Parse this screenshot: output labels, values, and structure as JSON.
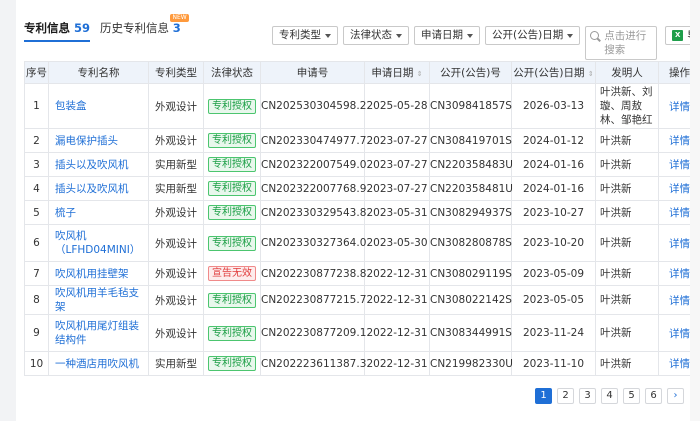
{
  "tabs": [
    {
      "label": "专利信息",
      "count": "59",
      "badge": ""
    },
    {
      "label": "历史专利信息",
      "count": "3",
      "badge": "NEW"
    }
  ],
  "toolbar": {
    "type_label": "专利类型",
    "status_label": "法律状态",
    "apply_date_label": "申请日期",
    "pub_date_label": "公开(公告)日期",
    "search_placeholder": "点击进行搜索",
    "export_label": "导出"
  },
  "table": {
    "headers": [
      "序号",
      "专利名称",
      "专利类型",
      "法律状态",
      "申请号",
      "申请日期",
      "公开(公告)号",
      "公开(公告)日期",
      "发明人",
      "操作"
    ],
    "rows": [
      {
        "no": "1",
        "name": "包装盒",
        "type": "外观设计",
        "status": "专利授权",
        "status_color": "green",
        "app_no": "CN202530304598.2",
        "app_date": "2025-05-28",
        "pub_no": "CN309841857S",
        "pub_date": "2026-03-13",
        "inventor": "叶洪新、刘璇、周敖林、邹艳红",
        "op": "详情"
      },
      {
        "no": "2",
        "name": "漏电保护插头",
        "type": "外观设计",
        "status": "专利授权",
        "status_color": "green",
        "app_no": "CN202330474977.7",
        "app_date": "2023-07-27",
        "pub_no": "CN308419701S",
        "pub_date": "2024-01-12",
        "inventor": "叶洪新",
        "op": "详情"
      },
      {
        "no": "3",
        "name": "插头以及吹风机",
        "type": "实用新型",
        "status": "专利授权",
        "status_color": "green",
        "app_no": "CN202322007549.0",
        "app_date": "2023-07-27",
        "pub_no": "CN220358483U",
        "pub_date": "2024-01-16",
        "inventor": "叶洪新",
        "op": "详情"
      },
      {
        "no": "4",
        "name": "插头以及吹风机",
        "type": "实用新型",
        "status": "专利授权",
        "status_color": "green",
        "app_no": "CN202322007768.9",
        "app_date": "2023-07-27",
        "pub_no": "CN220358481U",
        "pub_date": "2024-01-16",
        "inventor": "叶洪新",
        "op": "详情"
      },
      {
        "no": "5",
        "name": "梳子",
        "type": "外观设计",
        "status": "专利授权",
        "status_color": "green",
        "app_no": "CN202330329543.8",
        "app_date": "2023-05-31",
        "pub_no": "CN308294937S",
        "pub_date": "2023-10-27",
        "inventor": "叶洪新",
        "op": "详情"
      },
      {
        "no": "6",
        "name": "吹风机（LFHD04MINI）",
        "type": "外观设计",
        "status": "专利授权",
        "status_color": "green",
        "app_no": "CN202330327364.0",
        "app_date": "2023-05-30",
        "pub_no": "CN308280878S",
        "pub_date": "2023-10-20",
        "inventor": "叶洪新",
        "op": "详情"
      },
      {
        "no": "7",
        "name": "吹风机用挂壁架",
        "type": "外观设计",
        "status": "宣告无效",
        "status_color": "red",
        "app_no": "CN202230877238.8",
        "app_date": "2022-12-31",
        "pub_no": "CN308029119S",
        "pub_date": "2023-05-09",
        "inventor": "叶洪新",
        "op": "详情"
      },
      {
        "no": "8",
        "name": "吹风机用羊毛毡支架",
        "type": "外观设计",
        "status": "专利授权",
        "status_color": "green",
        "app_no": "CN202230877215.7",
        "app_date": "2022-12-31",
        "pub_no": "CN308022142S",
        "pub_date": "2023-05-05",
        "inventor": "叶洪新",
        "op": "详情"
      },
      {
        "no": "9",
        "name": "吹风机用尾灯组装结构件",
        "type": "外观设计",
        "status": "专利授权",
        "status_color": "green",
        "app_no": "CN202230877209.1",
        "app_date": "2022-12-31",
        "pub_no": "CN308344991S",
        "pub_date": "2023-11-24",
        "inventor": "叶洪新",
        "op": "详情"
      },
      {
        "no": "10",
        "name": "一种酒店用吹风机",
        "type": "实用新型",
        "status": "专利授权",
        "status_color": "green",
        "app_no": "CN202223611387.3",
        "app_date": "2022-12-31",
        "pub_no": "CN219982330U",
        "pub_date": "2023-11-10",
        "inventor": "叶洪新",
        "op": "详情"
      }
    ]
  },
  "pagination": {
    "pages": [
      "1",
      "2",
      "3",
      "4",
      "5",
      "6"
    ],
    "current": "1",
    "next": "›"
  }
}
